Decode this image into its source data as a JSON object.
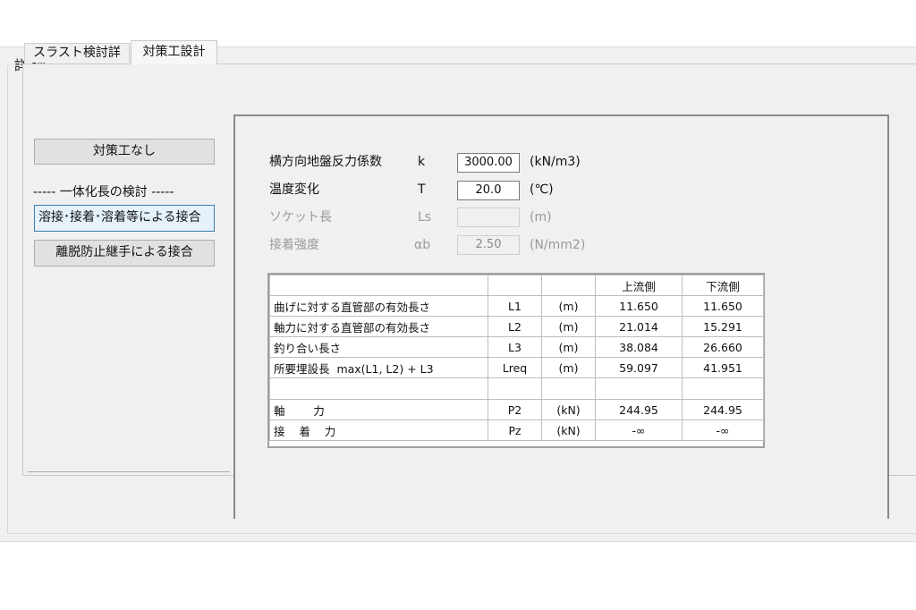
{
  "group": {
    "title": "詳 細"
  },
  "tabs": [
    {
      "label": "スラスト検討詳細",
      "active": false
    },
    {
      "label": "対策工設計",
      "active": true
    }
  ],
  "left": {
    "no_measure_button": "対策工なし",
    "section_label": "----- 一体化長の検討 -----",
    "weld_button": "溶接･接着･溶着等による接合",
    "detach_button": "離脱防止継手による接合"
  },
  "params": [
    {
      "label": "横方向地盤反力係数",
      "symbol": "k",
      "value": "3000.00",
      "unit": "(kN/m3)",
      "enabled": true
    },
    {
      "label": "温度変化",
      "symbol": "T",
      "value": "20.0",
      "unit": "(℃)",
      "enabled": true
    },
    {
      "label": "ソケット長",
      "symbol": "Ls",
      "value": "",
      "unit": "(m)",
      "enabled": false
    },
    {
      "label": "接着強度",
      "symbol": "αb",
      "value": "2.50",
      "unit": "(N/mm2)",
      "enabled": false
    }
  ],
  "table": {
    "headers": [
      "",
      "",
      "",
      "上流側",
      "下流側"
    ],
    "rows": [
      [
        "曲げに対する直管部の有効長さ",
        "L1",
        "(m)",
        "11.650",
        "11.650"
      ],
      [
        "軸力に対する直管部の有効長さ",
        "L2",
        "(m)",
        "21.014",
        "15.291"
      ],
      [
        "釣り合い長さ",
        "L3",
        "(m)",
        "38.084",
        "26.660"
      ],
      [
        "所要埋設長  max(L1, L2) + L3",
        "Lreq",
        "(m)",
        "59.097",
        "41.951"
      ],
      [
        "",
        "",
        "",
        "",
        ""
      ],
      [
        "軸        力",
        "P2",
        "(kN)",
        "244.95",
        "244.95"
      ],
      [
        "接    着    力",
        "Pz",
        "(kN)",
        "-∞",
        "-∞"
      ]
    ]
  }
}
